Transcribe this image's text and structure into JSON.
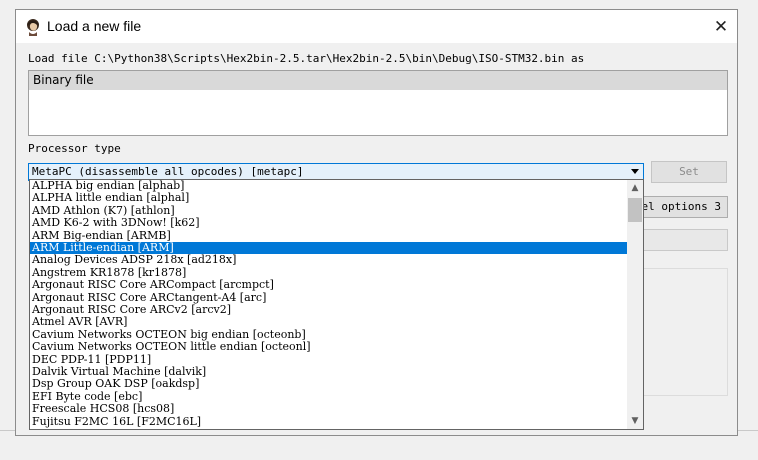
{
  "dialog": {
    "title": "Load a new file",
    "close_glyph": "✕",
    "load_label": "Load file C:\\Python38\\Scripts\\Hex2bin-2.5.tar\\Hex2bin-2.5\\bin\\Debug\\ISO-STM32.bin as",
    "file_types": [
      "Binary file"
    ],
    "processor_label": "Processor type",
    "processor_selected": "MetaPC (disassemble all opcodes) [metapc]",
    "set_label": "Set",
    "kernel_options_label": "el options 3"
  },
  "processor_list": {
    "selected_index": 5,
    "items": [
      "ALPHA big endian [alphab]",
      "ALPHA little endian [alphal]",
      "AMD Athlon (K7) [athlon]",
      "AMD K6-2 with 3DNow! [k62]",
      "ARM Big-endian [ARMB]",
      "ARM Little-endian [ARM]",
      "Analog Devices ADSP 218x [ad218x]",
      "Angstrem KR1878 [kr1878]",
      "Argonaut RISC Core ARCompact [arcmpct]",
      "Argonaut RISC Core ARCtangent-A4 [arc]",
      "Argonaut RISC Core ARCv2 [arcv2]",
      "Atmel AVR [AVR]",
      "Cavium Networks OCTEON big endian [octeonb]",
      "Cavium Networks OCTEON little endian [octeonl]",
      "DEC PDP-11 [PDP11]",
      "Dalvik Virtual Machine [dalvik]",
      "Dsp Group OAK DSP [oakdsp]",
      "EFI Byte code [ebc]",
      "Freescale HCS08 [hcs08]",
      "Fujitsu F2MC 16L [F2MC16L]"
    ]
  },
  "scrollbar": {
    "up_glyph": "▲",
    "down_glyph": "▼"
  },
  "colors": {
    "selection": "#0078d7",
    "combo_border": "#0078d7",
    "combo_bg": "#e5f1fb"
  }
}
